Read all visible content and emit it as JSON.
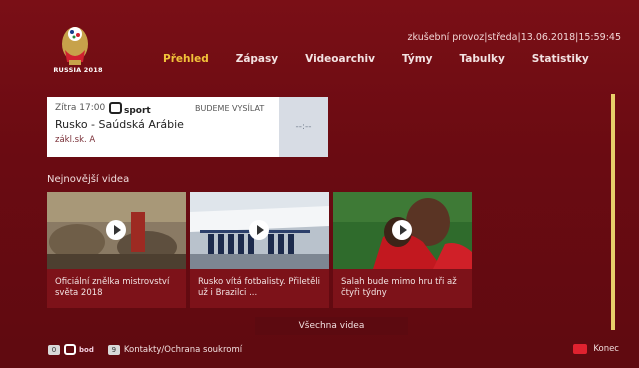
{
  "logo": {
    "text": "RUSSIA 2018"
  },
  "status": {
    "mode": "zkušební provoz",
    "day": "středa",
    "date": "13.06.2018",
    "time": "15:59:45"
  },
  "nav": {
    "tabs": [
      {
        "label": "Přehled",
        "active": true
      },
      {
        "label": "Zápasy"
      },
      {
        "label": "Videoarchiv"
      },
      {
        "label": "Týmy"
      },
      {
        "label": "Tabulky"
      },
      {
        "label": "Statistiky"
      }
    ]
  },
  "match": {
    "time": "Zítra 17:00",
    "channel": "sport",
    "broadcast": "BUDEME VYSÍLAT",
    "title": "Rusko - Saúdská Arábie",
    "group": "zákl.sk. A",
    "score": "--:--"
  },
  "videos": {
    "section_title": "Nejnovější videa",
    "items": [
      {
        "caption": "Oficiální znělka mistrovství světa 2018"
      },
      {
        "caption": "Rusko vítá fotbalisty. Přiletěli už i Brazilci ..."
      },
      {
        "caption": "Salah bude mimo hru tři až čtyři týdny"
      }
    ],
    "all_label": "Všechna videa"
  },
  "footer": {
    "key0": "0",
    "bod_label": "bod",
    "key9": "9",
    "contacts": "Kontakty/Ochrana soukromí",
    "exit": "Konec"
  },
  "colors": {
    "background": "#6e0b12",
    "accent": "#f2c23a",
    "scrollbar": "#e8cf6a",
    "exit_button": "#e0222f"
  }
}
